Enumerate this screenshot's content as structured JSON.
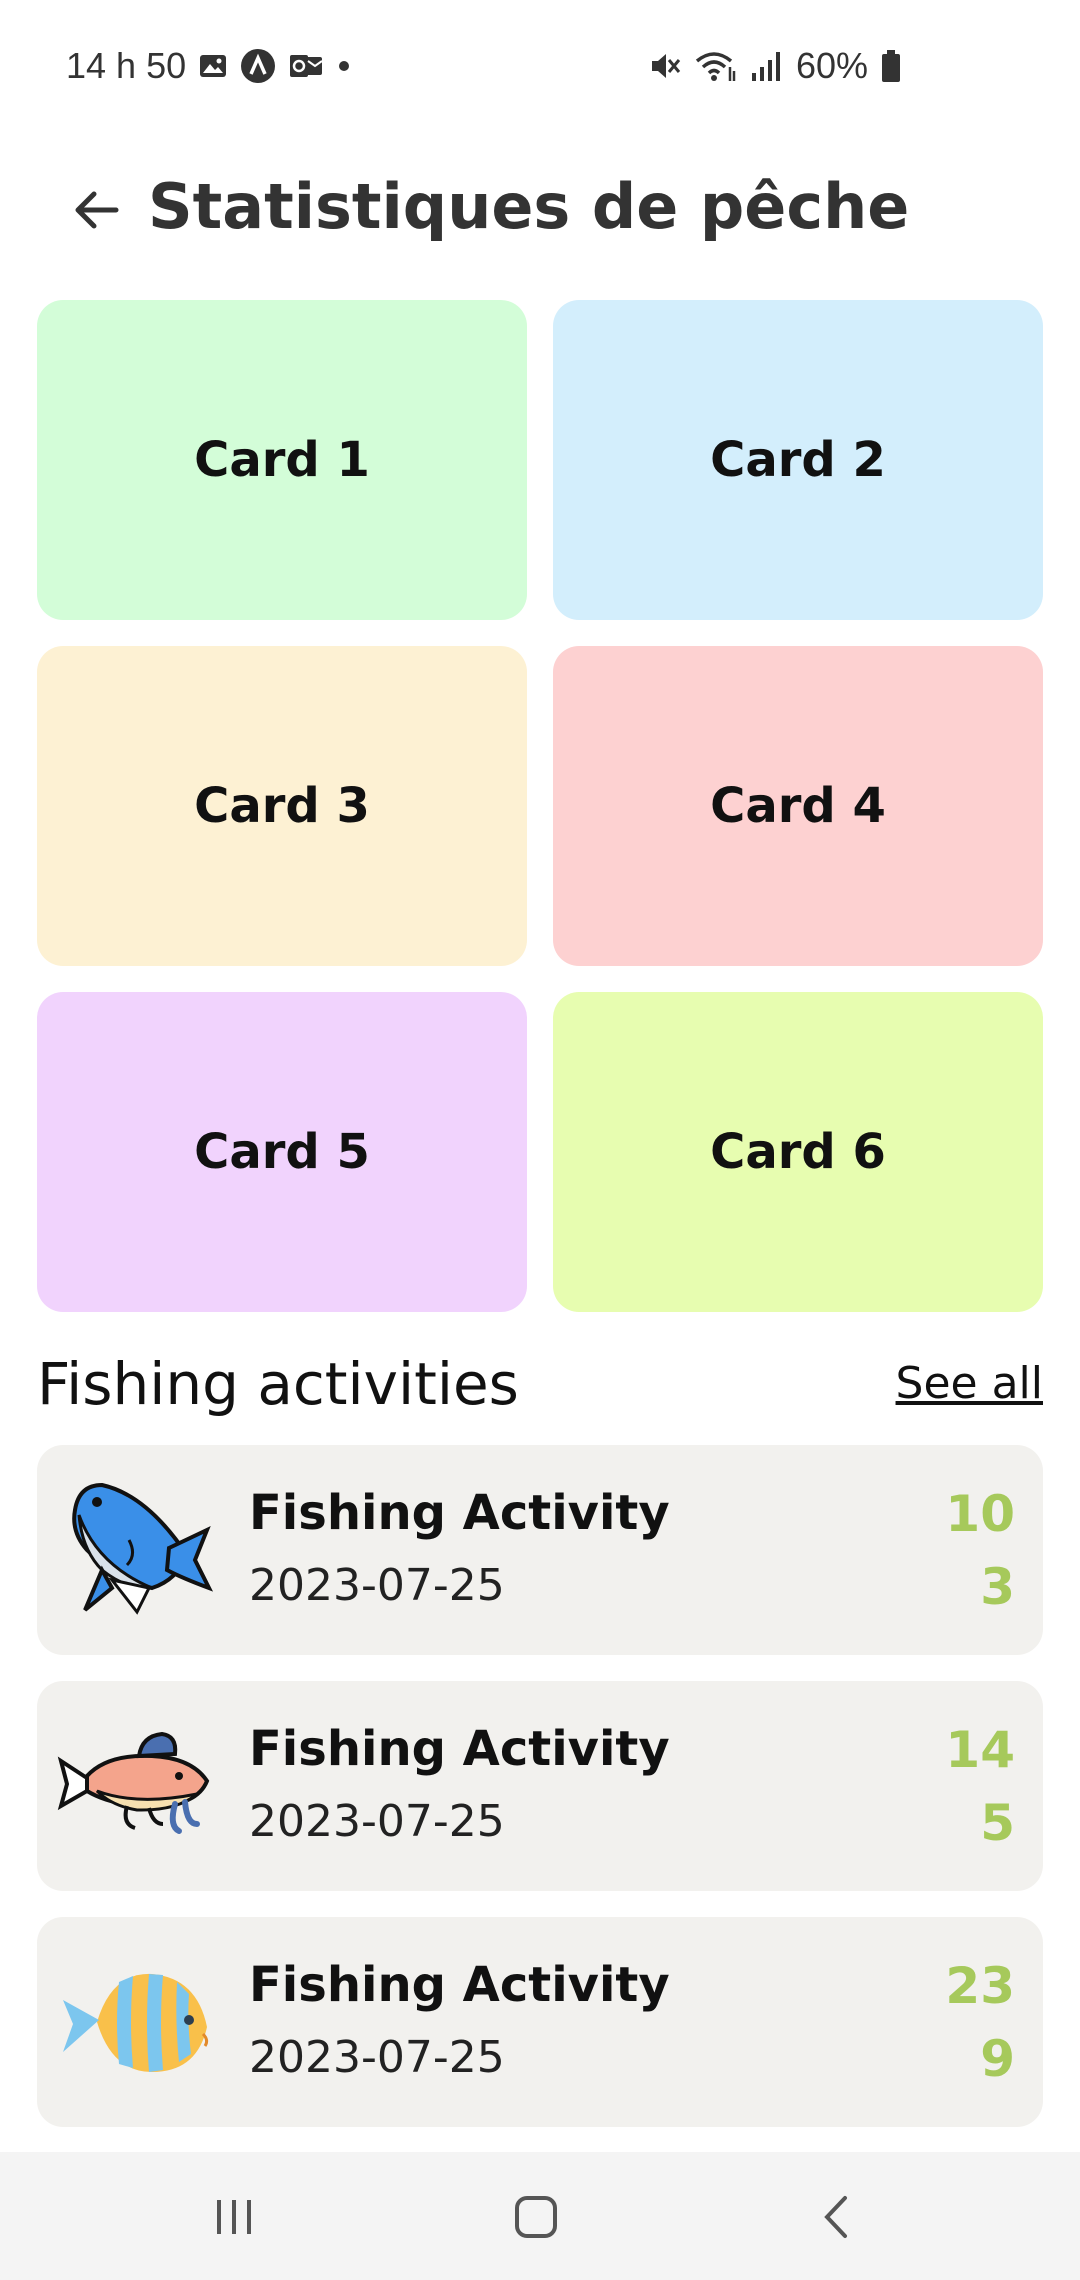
{
  "status_bar": {
    "time": "14 h 50",
    "battery": "60%",
    "icons_left": [
      "image-icon",
      "app-a-icon",
      "outlook-icon",
      "dot-icon"
    ],
    "icons_right": [
      "mute-icon",
      "wifi-icon",
      "signal-icon",
      "battery-icon"
    ]
  },
  "header": {
    "title": "Statistiques de pêche"
  },
  "cards": [
    {
      "label": "Card 1",
      "color": "#d3fdd8"
    },
    {
      "label": "Card 2",
      "color": "#d3eefc"
    },
    {
      "label": "Card 3",
      "color": "#fdf1d3"
    },
    {
      "label": "Card 4",
      "color": "#fdd1d1"
    },
    {
      "label": "Card 5",
      "color": "#f1d3fd"
    },
    {
      "label": "Card 6",
      "color": "#e7fdb0"
    }
  ],
  "section": {
    "title": "Fishing activities",
    "see_all": "See all"
  },
  "activities": [
    {
      "title": "Fishing Activity",
      "date": "2023-07-25",
      "value1": "10",
      "value2": "3",
      "icon": "tuna-fish-icon"
    },
    {
      "title": "Fishing Activity",
      "date": "2023-07-25",
      "value1": "14",
      "value2": "5",
      "icon": "catfish-icon"
    },
    {
      "title": "Fishing Activity",
      "date": "2023-07-25",
      "value1": "23",
      "value2": "9",
      "icon": "tropical-fish-icon"
    }
  ],
  "colors": {
    "accent": "#a6c95b",
    "activity_bg": "#f2f1ee"
  },
  "nav": {
    "icons": [
      "recent-apps-icon",
      "home-icon",
      "back-icon"
    ]
  }
}
